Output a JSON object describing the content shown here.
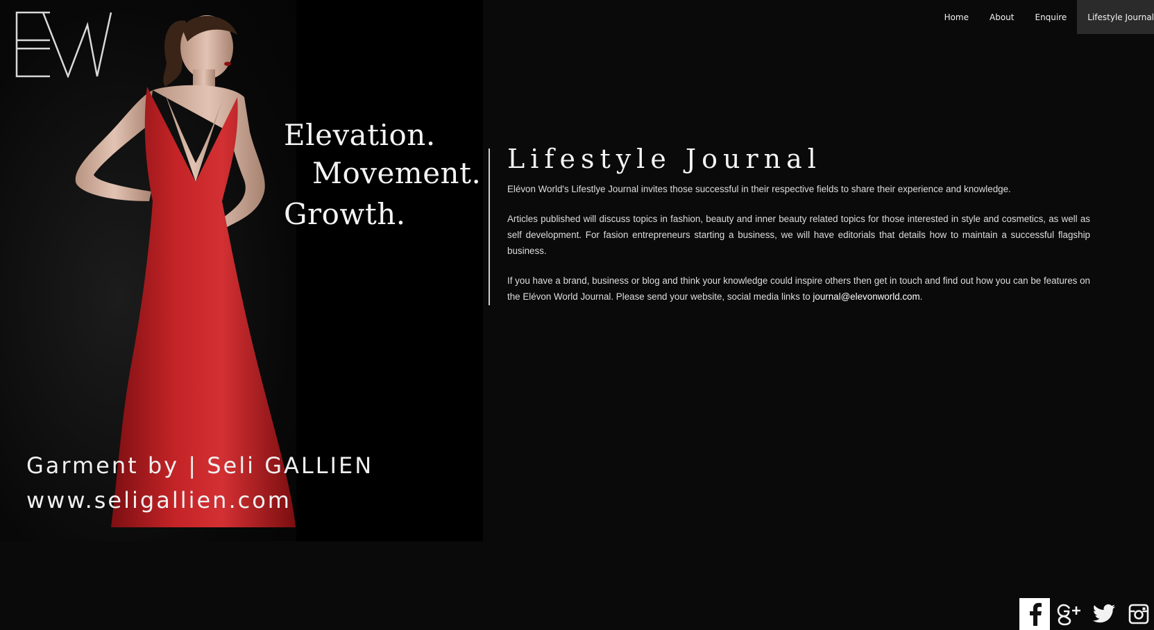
{
  "nav": {
    "items": [
      {
        "label": "Home",
        "active": false
      },
      {
        "label": "About",
        "active": false
      },
      {
        "label": "Enquire",
        "active": false
      },
      {
        "label": "Lifestyle Journal",
        "active": true
      }
    ]
  },
  "logo": {
    "text": "EW"
  },
  "hero": {
    "tagline": [
      "Elevation.",
      "Movement.",
      "Growth."
    ],
    "garment_credit": "Garment by | Seli GALLIEN",
    "garment_url": "www.seligallien.com"
  },
  "content": {
    "title": "Lifestyle Journal",
    "paragraph1": "Elévon World's Lifestlye Journal invites those successful in their respective fields to share their experience and knowledge.",
    "paragraph2": "Articles published will discuss topics in fashion, beauty and inner beauty related topics for those interested in style and cosmetics, as well as self development. For fasion entrepreneurs starting a business, we will have editorials that details how to maintain a successful flagship business.",
    "paragraph3": "If you have a brand, business or blog and think your knowledge could inspire others then get in touch and find out how you can be features on the Elévon World Journal. Please send your website, social media links to ",
    "email": "journal@elevonworld.com",
    "paragraph3_end": "."
  },
  "social": [
    {
      "icon": "facebook-icon"
    },
    {
      "icon": "google-plus-icon"
    },
    {
      "icon": "twitter-icon"
    },
    {
      "icon": "instagram-icon"
    }
  ],
  "colors": {
    "background": "#0a0a0a",
    "nav_active": "#2b2b2b",
    "dress": "#b51d1f",
    "text": "#e8e8e8"
  }
}
